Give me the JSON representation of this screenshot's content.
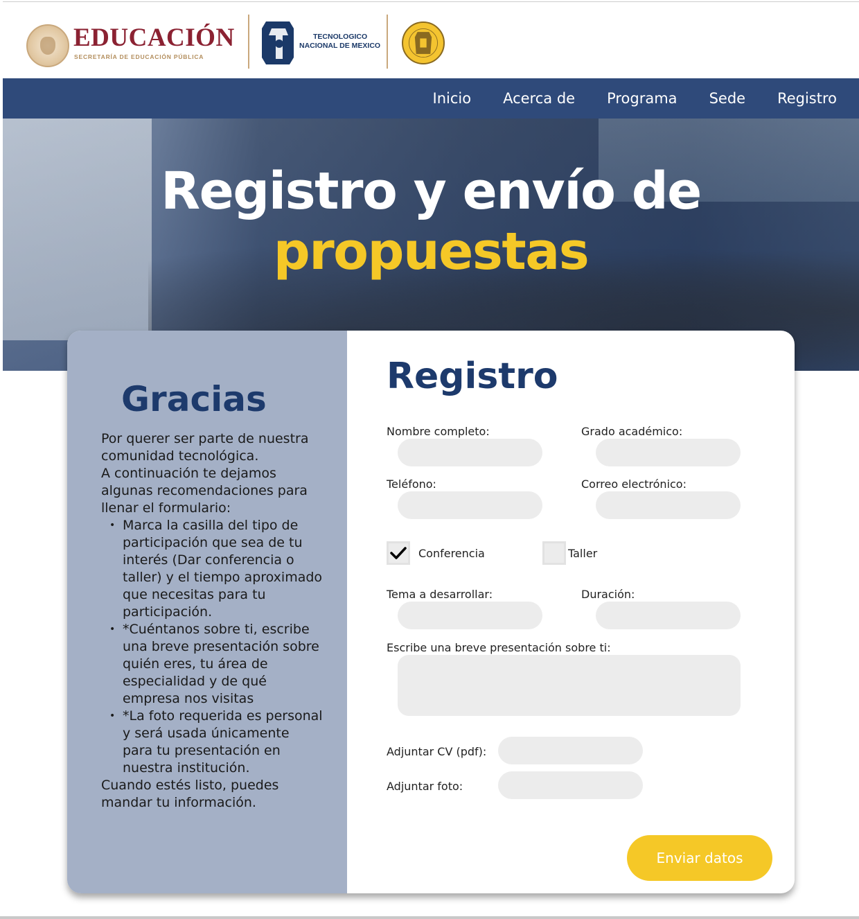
{
  "header": {
    "edu_title": "EDUCACIÓN",
    "edu_subtitle": "SECRETARÍA DE EDUCACIÓN PÚBLICA",
    "tecnm_line1": "TECNOLOGICO",
    "tecnm_line2": "NACIONAL DE MEXICO"
  },
  "nav": {
    "items": [
      {
        "label": "Inicio"
      },
      {
        "label": "Acerca de"
      },
      {
        "label": "Programa"
      },
      {
        "label": "Sede"
      },
      {
        "label": "Registro"
      }
    ]
  },
  "hero": {
    "title_line1": "Registro y envío de",
    "title_line2": "propuestas"
  },
  "sidebar": {
    "title": "Gracias",
    "intro1": "Por querer ser parte de nuestra comunidad tecnológica.",
    "intro2": "A continuación te dejamos algunas recomendaciones para llenar el formulario:",
    "bullets": [
      "Marca la casilla del tipo de participación que sea de tu interés (Dar conferencia o taller) y el tiempo aproximado que necesitas para tu participación.",
      "*Cuéntanos sobre ti, escribe una breve presentación sobre quién eres, tu área de especialidad y de qué empresa nos visitas",
      "*La foto requerida es personal y será usada únicamente para tu presentación en nuestra institución."
    ],
    "closing": "Cuando estés listo, puedes mandar tu información."
  },
  "form": {
    "title": "Registro",
    "nombre_label": "Nombre completo:",
    "grado_label": "Grado académico:",
    "telefono_label": "Teléfono:",
    "correo_label": "Correo electrónico:",
    "conferencia_label": "Conferencia",
    "conferencia_checked": true,
    "taller_label": "Taller",
    "taller_checked": false,
    "tema_label": "Tema a desarrollar:",
    "duracion_label": "Duración:",
    "presentacion_label": "Escribe una breve presentación sobre ti:",
    "cv_label": "Adjuntar CV (pdf):",
    "foto_label": "Adjuntar foto:",
    "submit_label": "Enviar datos"
  },
  "colors": {
    "navy": "#2f4a7a",
    "title_navy": "#1d3a6c",
    "accent_yellow": "#f5c827",
    "sidebar_bg": "#a4b0c6",
    "input_bg": "#ececec",
    "edu_maroon": "#8b2232",
    "edu_gold": "#b38e5d"
  }
}
